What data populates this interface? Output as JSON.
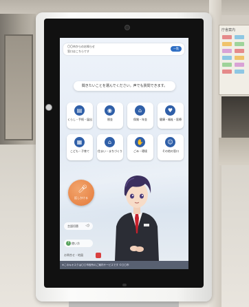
{
  "scene": {
    "directory_board_title": "庁舎案内"
  },
  "notice": {
    "line1": "〇〇市からのお知らせ",
    "line2": "窓口はこちらです",
    "pill": "一覧"
  },
  "prompt": "聞きたいことを選んでください。声でも質問できます。",
  "categories": [
    {
      "label": "くらし・手続・届出",
      "icon": "document-icon",
      "glyph": "▤"
    },
    {
      "label": "税金",
      "icon": "coin-icon",
      "glyph": "◉"
    },
    {
      "label": "保険・年金",
      "icon": "house-icon",
      "glyph": "⌂"
    },
    {
      "label": "健康・福祉・医療",
      "icon": "heart-icon",
      "glyph": "♥"
    },
    {
      "label": "こども・子育て",
      "icon": "building-icon",
      "glyph": "▦"
    },
    {
      "label": "住まい・まちづくり",
      "icon": "home-icon",
      "glyph": "⌂"
    },
    {
      "label": "ごみ・環境",
      "icon": "hand-icon",
      "glyph": "✋"
    },
    {
      "label": "その他の窓口",
      "icon": "person-icon",
      "glyph": "☺"
    }
  ],
  "mic": {
    "label": "話しかける"
  },
  "language": {
    "label": "言語切替"
  },
  "help": {
    "label": "使い方"
  },
  "status": {
    "label": "お問合せ・地図"
  },
  "footer": "※このキオスクは〇〇市役所のご案内サービスです ©〇〇市"
}
